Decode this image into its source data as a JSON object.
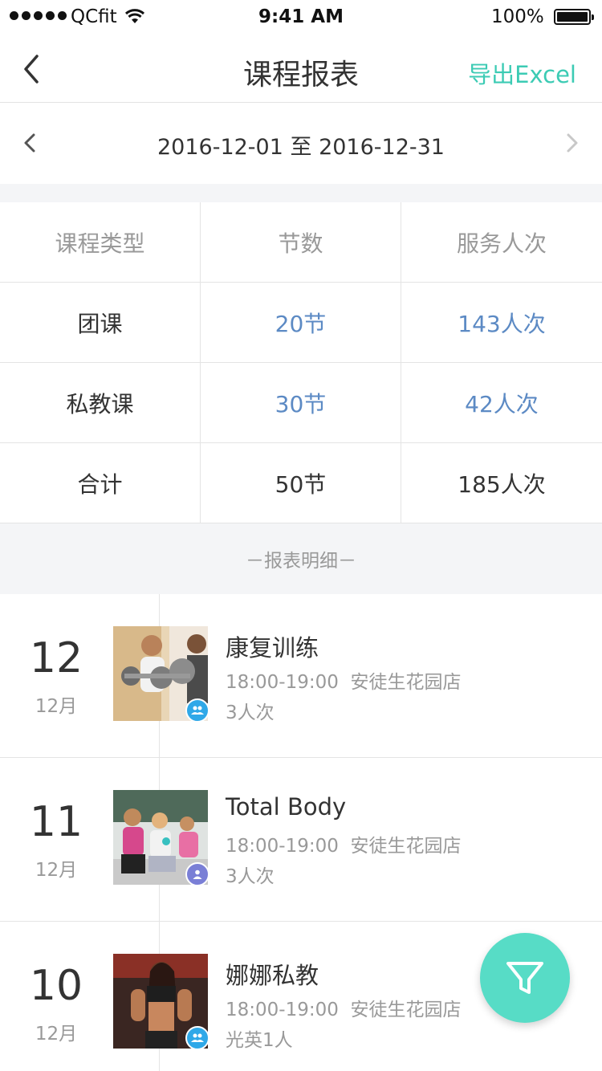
{
  "status_bar": {
    "carrier": "QCfit",
    "time": "9:41 AM",
    "battery": "100%"
  },
  "nav": {
    "title": "课程报表",
    "export_label": "导出Excel"
  },
  "date_range": {
    "text": "2016-12-01 至 2016-12-31"
  },
  "summary": {
    "headers": [
      "课程类型",
      "节数",
      "服务人次"
    ],
    "rows": [
      {
        "type": "团课",
        "sessions": "20节",
        "people": "143人次"
      },
      {
        "type": "私教课",
        "sessions": "30节",
        "people": "42人次"
      },
      {
        "type": "合计",
        "sessions": "50节",
        "people": "185人次"
      }
    ]
  },
  "detail_header": "－报表明细－",
  "items": [
    {
      "day": "12",
      "month": "12月",
      "title": "康复训练",
      "time": "18:00-19:00",
      "store": "安徒生花园店",
      "count": "3人次",
      "badge_icon": "group-icon",
      "badge_color": "#2fa8e8"
    },
    {
      "day": "11",
      "month": "12月",
      "title": "Total Body",
      "time": "18:00-19:00",
      "store": "安徒生花园店",
      "count": "3人次",
      "badge_icon": "person-icon",
      "badge_color": "#7a7fd6"
    },
    {
      "day": "10",
      "month": "12月",
      "title": "娜娜私教",
      "time": "18:00-19:00",
      "store": "安徒生花园店",
      "count": "光英1人",
      "badge_icon": "group-icon",
      "badge_color": "#2fa8e8"
    }
  ],
  "colors": {
    "accent": "#3ccbb4",
    "fab": "#57dcc6",
    "value_blue": "#5c8ac4"
  },
  "fab_icon": "filter-icon"
}
